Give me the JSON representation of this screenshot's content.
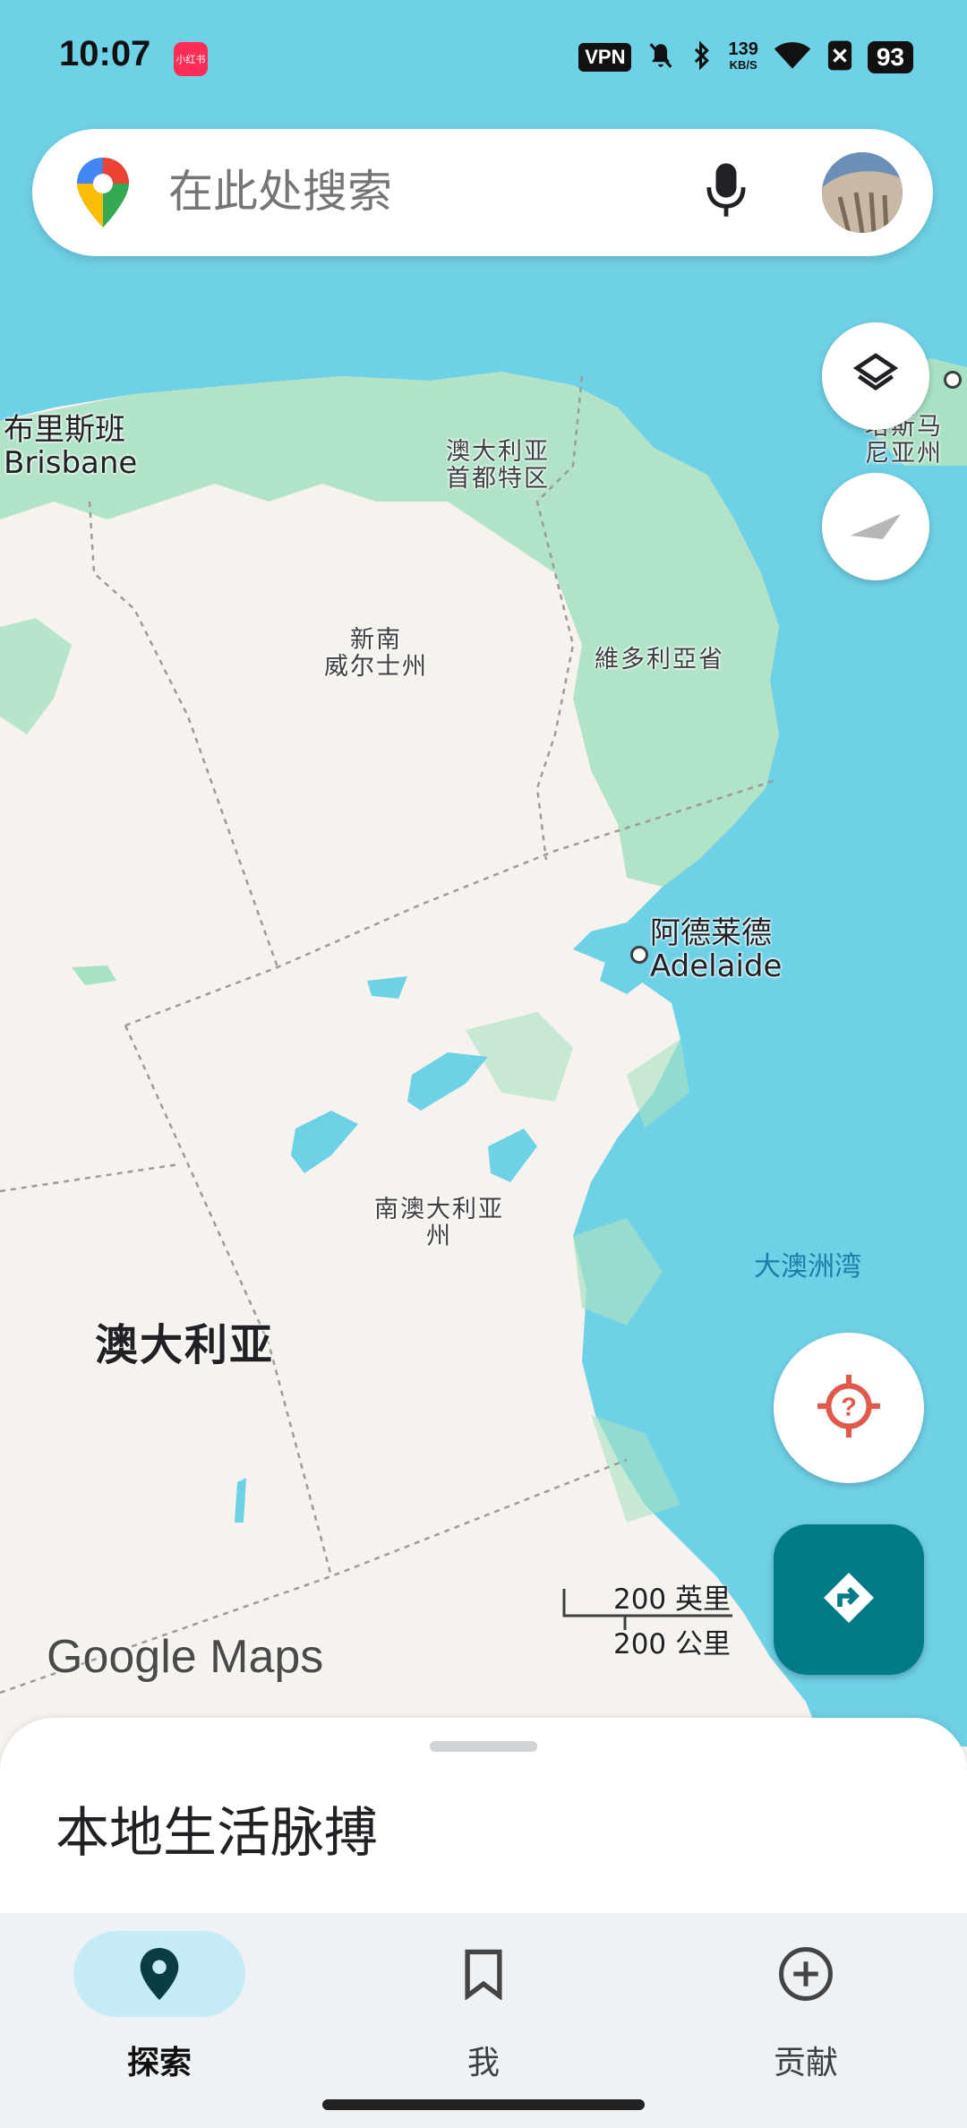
{
  "status_bar": {
    "time": "10:07",
    "app_badge": "小红书",
    "vpn": "VPN",
    "speed_value": "139",
    "speed_unit": "KB/S",
    "battery": "93"
  },
  "search": {
    "placeholder": "在此处搜索",
    "icons": [
      "google-maps-pin-icon",
      "mic-icon",
      "avatar"
    ]
  },
  "map_controls": {
    "icons": [
      "layers-icon",
      "compass-icon",
      "my-location-unknown-icon",
      "directions-icon"
    ]
  },
  "map_labels": {
    "brisbane_cn": "布里斯班",
    "brisbane_en": "Brisbane",
    "act": "澳大利亚\n首都特区",
    "nsw": "新南\n威尔士州",
    "victoria": "維多利亞省",
    "tasmania": "塔斯马\n尼亚州",
    "adelaide_cn": "阿德莱德",
    "adelaide_en": "Adelaide",
    "south_australia": "南澳大利亚\n州",
    "australia": "澳大利亚",
    "great_australian_bight": "大澳洲湾"
  },
  "scale": {
    "miles": "200 英里",
    "km": "200 公里"
  },
  "logo": "Google Maps",
  "sheet": {
    "title": "本地生活脉搏"
  },
  "bottom_nav": {
    "items": [
      {
        "label": "探索",
        "icon": "place-pin-icon",
        "active": true
      },
      {
        "label": "我",
        "icon": "bookmark-icon",
        "active": false
      },
      {
        "label": "贡献",
        "icon": "add-circle-icon",
        "active": false
      }
    ]
  },
  "colors": {
    "water": "#6fd1e6",
    "land": "#f6f3ee",
    "forest": "#a8e1c3",
    "accent": "#017b87",
    "location_red": "#e0594b"
  }
}
